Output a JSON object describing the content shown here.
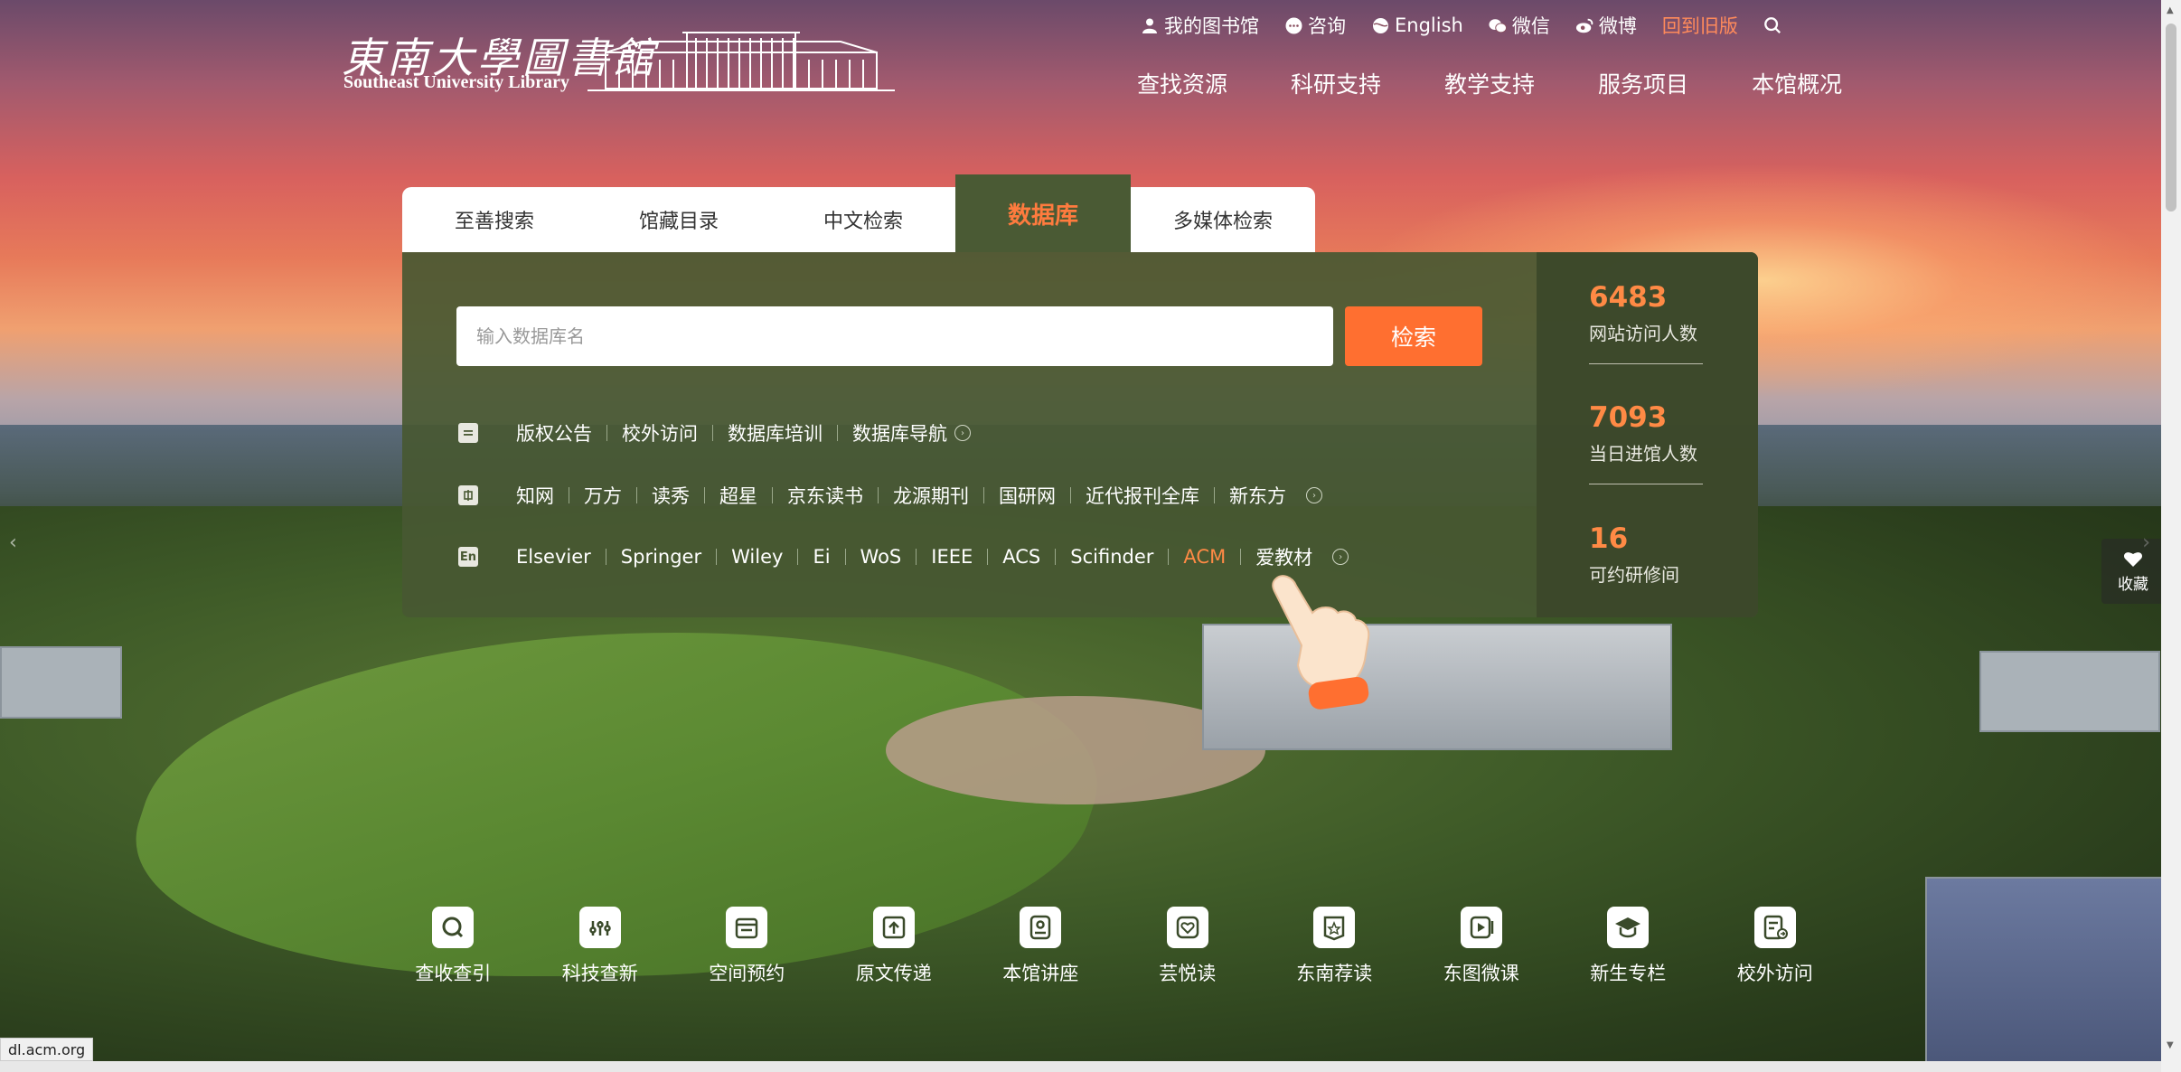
{
  "logo": {
    "cn": "東南大學圖書館",
    "en": "Southeast University Library"
  },
  "topbar": {
    "items": [
      {
        "icon": "user-icon",
        "label": "我的图书馆"
      },
      {
        "icon": "chat-icon",
        "label": "咨询"
      },
      {
        "icon": "globe-icon",
        "label": "English"
      },
      {
        "icon": "wechat-icon",
        "label": "微信"
      },
      {
        "icon": "weibo-icon",
        "label": "微博"
      }
    ],
    "old_version": "回到旧版",
    "search_icon": "search-icon"
  },
  "mainnav": [
    "查找资源",
    "科研支持",
    "教学支持",
    "服务项目",
    "本馆概况"
  ],
  "tabs": {
    "items": [
      "至善搜索",
      "馆藏目录",
      "中文检索",
      "数据库",
      "多媒体检索"
    ],
    "active": "数据库"
  },
  "search": {
    "placeholder": "输入数据库名",
    "button": "检索"
  },
  "rows": {
    "general": {
      "icon": "document-icon",
      "links": [
        "版权公告",
        "校外访问",
        "数据库培训",
        "数据库导航"
      ]
    },
    "chinese": {
      "icon": "chinese-db-icon",
      "links": [
        "知网",
        "万方",
        "读秀",
        "超星",
        "京东读书",
        "龙源期刊",
        "国研网",
        "近代报刊全库",
        "新东方"
      ]
    },
    "english": {
      "icon": "english-db-icon",
      "icon_text": "En",
      "links": [
        "Elsevier",
        "Springer",
        "Wiley",
        "Ei",
        "WoS",
        "IEEE",
        "ACS",
        "Scifinder",
        "ACM",
        "爱教材"
      ],
      "highlighted": "ACM"
    }
  },
  "stats": [
    {
      "value": "6483",
      "label": "网站访问人数"
    },
    {
      "value": "7093",
      "label": "当日进馆人数"
    },
    {
      "value": "16",
      "label": "可约研修间"
    }
  ],
  "quick_links": [
    {
      "icon": "search-icon",
      "label": "查收查引"
    },
    {
      "icon": "tech-icon",
      "label": "科技查新"
    },
    {
      "icon": "calendar-icon",
      "label": "空间预约"
    },
    {
      "icon": "upload-icon",
      "label": "原文传递"
    },
    {
      "icon": "lecture-icon",
      "label": "本馆讲座"
    },
    {
      "icon": "heart-icon",
      "label": "芸悦读"
    },
    {
      "icon": "star-badge-icon",
      "label": "东南荐读"
    },
    {
      "icon": "video-icon",
      "label": "东图微课"
    },
    {
      "icon": "graduation-cap-icon",
      "label": "新生专栏"
    },
    {
      "icon": "remote-access-icon",
      "label": "校外访问"
    }
  ],
  "favorite": "收藏",
  "status_url": "dl.acm.org",
  "colors": {
    "accent": "#ff6f30",
    "panel": "#485832",
    "highlight": "#ff8a45"
  }
}
